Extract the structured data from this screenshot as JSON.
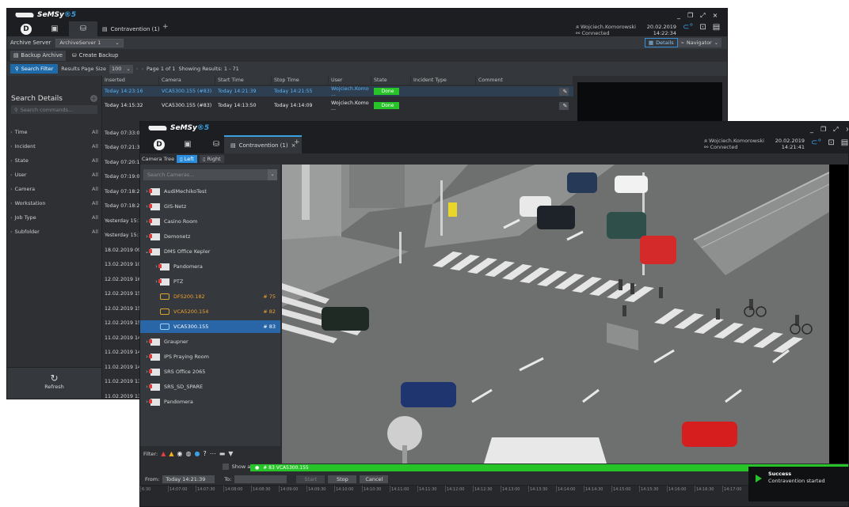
{
  "app": {
    "brand_name": "SeMSy",
    "brand_sup": "®5"
  },
  "win1": {
    "doc_tab": "Contravention (1)",
    "user": "Wojciech.Komorowski",
    "connection": "Connected",
    "date": "20.02.2019",
    "time": "14:22:34",
    "archive_server_label": "Archive Server",
    "archive_server_value": "ArchiveServer 1",
    "details_label": "Details",
    "navigator_label": "Navigator",
    "subtabs": [
      "Backup Archive",
      "Create Backup"
    ],
    "search_filter": "Search Filter",
    "page_size_label": "Results Page Size",
    "page_size_value": "100",
    "page_info": "Page 1 of 1",
    "results_info": "Showing Results: 1 - 71",
    "left": {
      "title": "Search Details",
      "search_placeholder": "Search commands...",
      "filters": [
        {
          "label": "Time",
          "value": "All"
        },
        {
          "label": "Incident",
          "value": "All"
        },
        {
          "label": "State",
          "value": "All"
        },
        {
          "label": "User",
          "value": "All"
        },
        {
          "label": "Camera",
          "value": "All"
        },
        {
          "label": "Workstation",
          "value": "All"
        },
        {
          "label": "Job Type",
          "value": "All"
        },
        {
          "label": "Subfolder",
          "value": "All"
        }
      ],
      "refresh": "Refresh"
    },
    "columns": [
      "Inserted",
      "Camera",
      "Start Time",
      "Stop Time",
      "User",
      "State",
      "Incident Type",
      "Comment"
    ],
    "rows": [
      {
        "inserted": "Today  14:23:16",
        "camera": "VCA5300.155 (#83)",
        "start": "Today  14:21:39",
        "stop": "Today  14:21:55",
        "user": "Wojciech.Komo ...",
        "state": "Done"
      },
      {
        "inserted": "Today  14:15:32",
        "camera": "VCA5300.155 (#83)",
        "start": "Today  14:13:50",
        "stop": "Today  14:14:09",
        "user": "Wojciech.Komo ...",
        "state": "Done"
      }
    ],
    "date_list": [
      "Today  07:33:0",
      "Today  07:21:3",
      "Today  07:20:1",
      "Today  07:19:0",
      "Today  07:18:2",
      "Today  07:18:2",
      "Yesterday  15:1",
      "Yesterday  15:1",
      "18.02.2019  09:",
      "13.02.2019  10:",
      "12.02.2019  16:",
      "12.02.2019  15:",
      "12.02.2019  15:",
      "12.02.2019  15:",
      "11.02.2019  14:",
      "11.02.2019  14:",
      "11.02.2019  14:",
      "11.02.2019  13:",
      "11.02.2019  13:",
      "08.02.2019  12:",
      "08.02.2019  09:",
      "08.02.2019  09:",
      "08.02.2019  09:"
    ]
  },
  "win2": {
    "doc_tab": "Contravention (1)",
    "user": "Wojciech.Komorowski",
    "connection": "Connected",
    "date": "20.02.2019",
    "time": "14:21:41",
    "camera_tree_label": "Camera Tree",
    "left_label": "Left",
    "right_label": "Right",
    "tree_search_placeholder": "Search Cameras...",
    "tree": [
      {
        "label": "AudiMechikoTest",
        "kind": "folder",
        "level": 0,
        "chev": "›"
      },
      {
        "label": "GIS-Netz",
        "kind": "folder",
        "level": 0,
        "chev": "›"
      },
      {
        "label": "Casino Room",
        "kind": "folder",
        "level": 0,
        "chev": "›"
      },
      {
        "label": "Demonetz",
        "kind": "folder",
        "level": 0,
        "chev": "›"
      },
      {
        "label": "DMS Office Kepler",
        "kind": "folder",
        "level": 0,
        "chev": "⌄"
      },
      {
        "label": "Pandomera",
        "kind": "folder",
        "level": 1,
        "chev": "›"
      },
      {
        "label": "PTZ",
        "kind": "folder",
        "level": 1,
        "chev": "›"
      },
      {
        "label": "DFS200.182",
        "kind": "camera",
        "level": 1,
        "chev": "",
        "num": "# 75"
      },
      {
        "label": "VCA5200.154",
        "kind": "camera",
        "level": 1,
        "chev": "",
        "num": "# 82"
      },
      {
        "label": "VCA5300.155",
        "kind": "camera-selected",
        "level": 1,
        "chev": "",
        "num": "# 83"
      },
      {
        "label": "Graupner",
        "kind": "folder",
        "level": 0,
        "chev": "›"
      },
      {
        "label": "IPS Praying Room",
        "kind": "folder",
        "level": 0,
        "chev": "›"
      },
      {
        "label": "SRS Office 2065",
        "kind": "folder",
        "level": 0,
        "chev": "›"
      },
      {
        "label": "SRS_SD_SPARE",
        "kind": "folder",
        "level": 0,
        "chev": "›"
      },
      {
        "label": "Pandomera",
        "kind": "folder",
        "level": 0,
        "chev": "›"
      }
    ],
    "filter_label": "Filter:",
    "show_all_statuses": "Show all Statuses",
    "stream_label": "# 83  VCA5300.155",
    "from_label": "From:",
    "from_value": "Today  14:21:39",
    "to_label": "To:",
    "start_btn": "Start",
    "stop_btn": "Stop",
    "cancel_btn": "Cancel",
    "ticks": [
      "6:30",
      "14:07:00",
      "14:07:30",
      "14:08:00",
      "14:08:30",
      "14:09:00",
      "14:09:30",
      "14:10:00",
      "14:10:30",
      "14:11:00",
      "14:11:30",
      "14:12:00",
      "14:12:30",
      "14:13:00",
      "14:13:30",
      "14:14:00",
      "14:14:30",
      "14:15:00",
      "14:15:30",
      "14:16:00",
      "14:16:30",
      "14:17:00",
      "14:17:30",
      "14:18:00",
      "14:18:30",
      "14:19:00"
    ]
  },
  "toast": {
    "title": "Success",
    "message": "Contravention started"
  },
  "colors": {
    "accent": "#3aa0e0",
    "success": "#27c429",
    "selection": "#2866a8"
  }
}
